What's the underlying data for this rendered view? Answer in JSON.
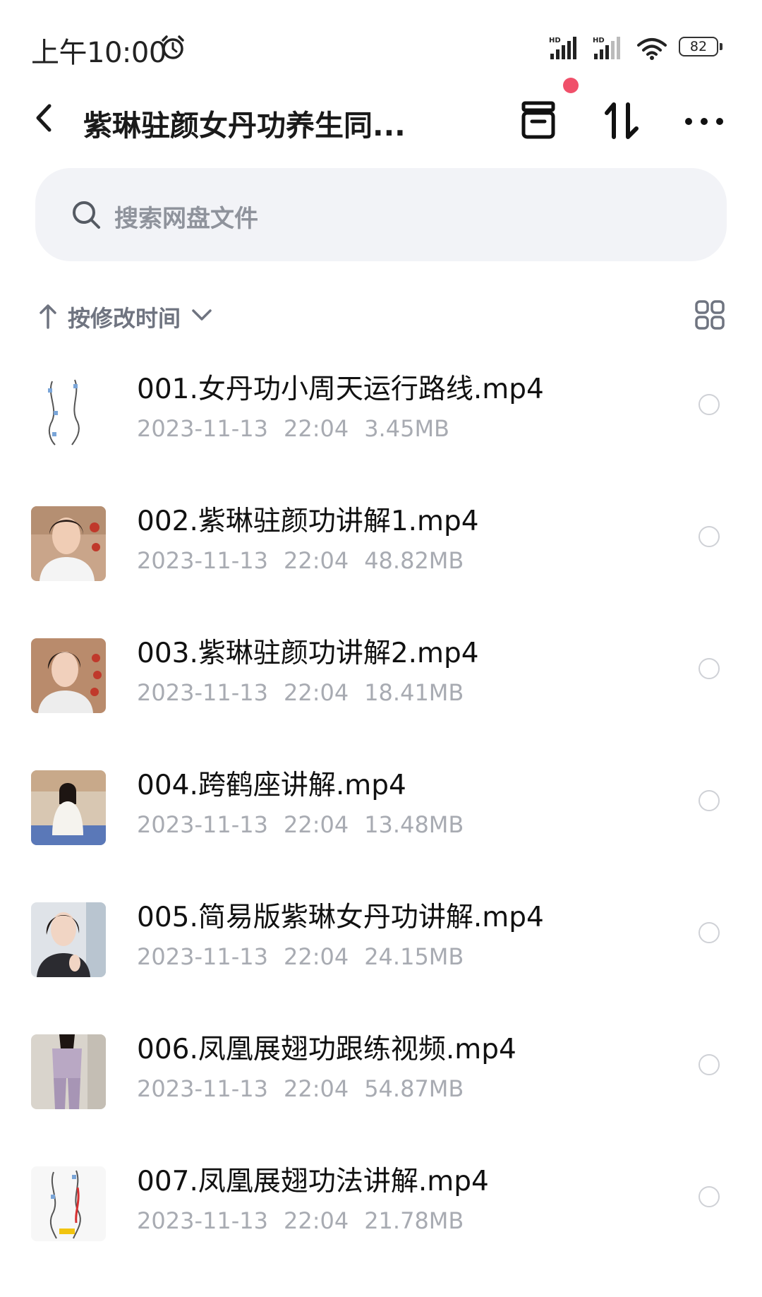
{
  "status_bar": {
    "time": "上午10:00",
    "battery": "82"
  },
  "header": {
    "title": "紫琳驻颜女丹功养生同...",
    "icons": {
      "back": "back-icon",
      "transfer": "transfer-icon",
      "sort_order": "sort-order-icon",
      "more": "more-icon"
    },
    "notification_dot_color": "#f0506a"
  },
  "search": {
    "placeholder": "搜索网盘文件"
  },
  "sort": {
    "label": "按修改时间"
  },
  "files": [
    {
      "name": "001.女丹功小周天运行路线.mp4",
      "date": "2023-11-13",
      "time": "22:04",
      "size": "3.45MB",
      "thumb": "diagram"
    },
    {
      "name": "002.紫琳驻颜功讲解1.mp4",
      "date": "2023-11-13",
      "time": "22:04",
      "size": "48.82MB",
      "thumb": "portrait"
    },
    {
      "name": "003.紫琳驻颜功讲解2.mp4",
      "date": "2023-11-13",
      "time": "22:04",
      "size": "18.41MB",
      "thumb": "portrait"
    },
    {
      "name": "004.跨鹤座讲解.mp4",
      "date": "2023-11-13",
      "time": "22:04",
      "size": "13.48MB",
      "thumb": "seated"
    },
    {
      "name": "005.简易版紫琳女丹功讲解.mp4",
      "date": "2023-11-13",
      "time": "22:04",
      "size": "24.15MB",
      "thumb": "portrait"
    },
    {
      "name": "006.凤凰展翅功跟练视频.mp4",
      "date": "2023-11-13",
      "time": "22:04",
      "size": "54.87MB",
      "thumb": "standing"
    },
    {
      "name": "007.凤凰展翅功法讲解.mp4",
      "date": "2023-11-13",
      "time": "22:04",
      "size": "21.78MB",
      "thumb": "diagram"
    }
  ]
}
